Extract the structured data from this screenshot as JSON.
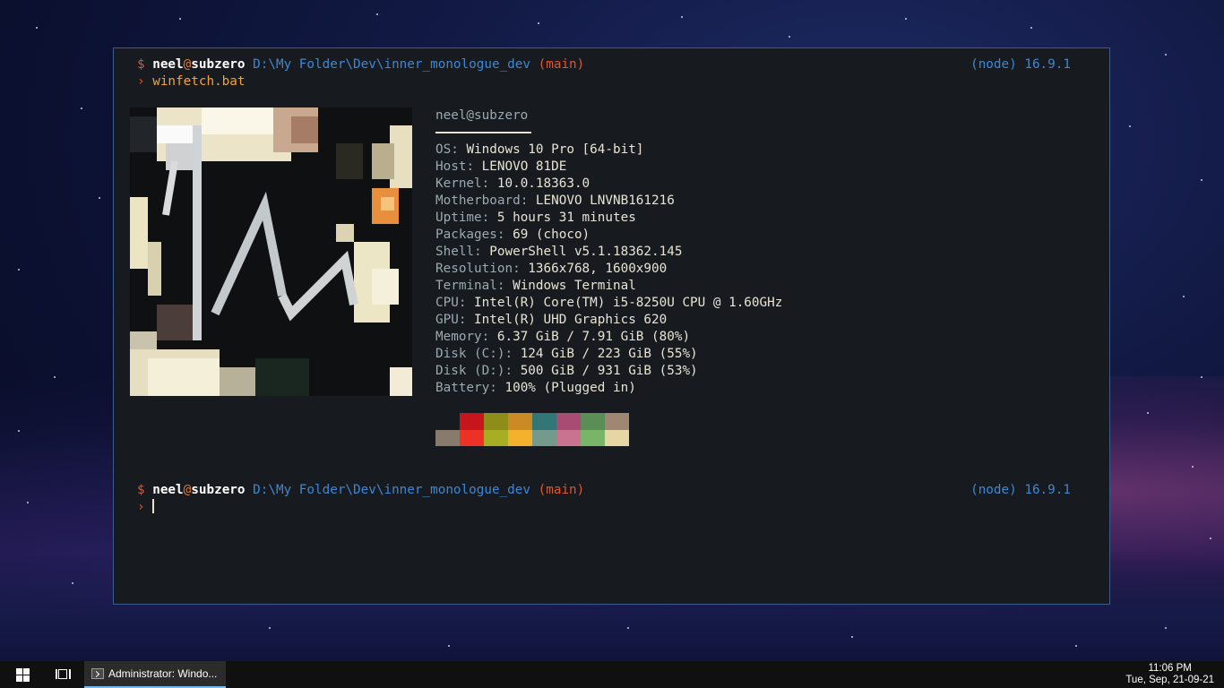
{
  "terminal": {
    "prompt1": {
      "dollar": "$",
      "user": "neel",
      "at": "@",
      "host": "subzero",
      "path": "D:\\My Folder\\Dev\\inner_monologue_dev",
      "branch": "(main)",
      "runtime": "(node) 16.9.1",
      "arrow": "›",
      "command": "winfetch.bat"
    },
    "info": {
      "userhost": "neel@subzero",
      "rows": [
        {
          "label": "OS",
          "value": "Windows 10 Pro [64-bit]"
        },
        {
          "label": "Host",
          "value": "LENOVO 81DE"
        },
        {
          "label": "Kernel",
          "value": "10.0.18363.0"
        },
        {
          "label": "Motherboard",
          "value": "LENOVO LNVNB161216"
        },
        {
          "label": "Uptime",
          "value": "5 hours 31 minutes"
        },
        {
          "label": "Packages",
          "value": "69 (choco)"
        },
        {
          "label": "Shell",
          "value": "PowerShell v5.1.18362.145"
        },
        {
          "label": "Resolution",
          "value": "1366x768, 1600x900"
        },
        {
          "label": "Terminal",
          "value": "Windows Terminal"
        },
        {
          "label": "CPU",
          "value": "Intel(R) Core(TM) i5-8250U CPU @ 1.60GHz"
        },
        {
          "label": "GPU",
          "value": "Intel(R) UHD Graphics 620"
        },
        {
          "label": "Memory",
          "value": "6.37 GiB / 7.91 GiB (80%)"
        },
        {
          "label": "Disk (C:)",
          "value": "124 GiB / 223 GiB (55%)"
        },
        {
          "label": "Disk (D:)",
          "value": "500 GiB / 931 GiB (53%)"
        },
        {
          "label": "Battery",
          "value": "100% (Plugged in)"
        }
      ]
    },
    "palette": {
      "top": [
        "#171b20",
        "#c6161b",
        "#8e8d1a",
        "#cb8a24",
        "#327676",
        "#a84c73",
        "#5b8e57",
        "#9e8872"
      ],
      "bottom": [
        "#887a6c",
        "#ee3127",
        "#a7ae23",
        "#f3b12e",
        "#749a8c",
        "#c97390",
        "#7ab468",
        "#e6d5a5"
      ]
    },
    "prompt2": {
      "dollar": "$",
      "user": "neel",
      "at": "@",
      "host": "subzero",
      "path": "D:\\My Folder\\Dev\\inner_monologue_dev",
      "branch": "(main)",
      "runtime": "(node) 16.9.1",
      "arrow": "›"
    }
  },
  "taskbar": {
    "start_icon": "windows-logo-icon",
    "taskview_icon": "task-view-icon",
    "app_label": "Administrator: Windo...",
    "time": "11:06 PM",
    "date": "Tue, Sep, 21-09-21"
  }
}
